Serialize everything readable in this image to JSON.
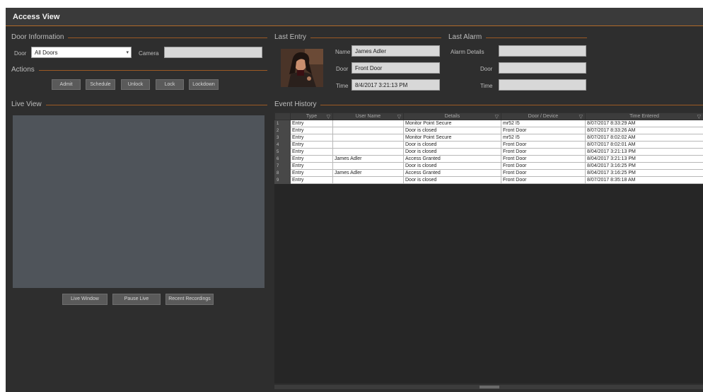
{
  "window": {
    "title": "Access View"
  },
  "door_information": {
    "section_label": "Door Information",
    "door_label": "Door",
    "door_value": "All Doors",
    "camera_label": "Camera",
    "camera_value": ""
  },
  "actions": {
    "section_label": "Actions",
    "buttons": [
      "Admit",
      "Schedule",
      "Unlock",
      "Lock",
      "Lockdown"
    ]
  },
  "live_view": {
    "section_label": "Live View",
    "buttons": [
      "Live Window",
      "Pause Live",
      "Recent Recordings"
    ]
  },
  "last_entry": {
    "section_label": "Last Entry",
    "name_label": "Name",
    "name_value": "James Adler",
    "door_label": "Door",
    "door_value": "Front Door",
    "time_label": "Time",
    "time_value": "8/4/2017 3:21:13 PM"
  },
  "last_alarm": {
    "section_label": "Last Alarm",
    "details_label": "Alarm Details",
    "details_value": "",
    "door_label": "Door",
    "door_value": "",
    "time_label": "Time",
    "time_value": ""
  },
  "event_history": {
    "section_label": "Event History",
    "columns": [
      "Type",
      "User Name",
      "Details",
      "Door / Device",
      "Time Entered"
    ],
    "rows": [
      {
        "num": "1",
        "type": "Entry",
        "user": "",
        "details": "Monitor Point Secure",
        "door": "mr52 I5",
        "time": "8/07/2017 8:33:29 AM"
      },
      {
        "num": "2",
        "type": "Entry",
        "user": "",
        "details": "Door is closed",
        "door": "Front Door",
        "time": "8/07/2017 8:33:26 AM"
      },
      {
        "num": "3",
        "type": "Entry",
        "user": "",
        "details": "Monitor Point Secure",
        "door": "mr52 I5",
        "time": "8/07/2017 8:02:02 AM"
      },
      {
        "num": "4",
        "type": "Entry",
        "user": "",
        "details": "Door is closed",
        "door": "Front Door",
        "time": "8/07/2017 8:02:01 AM"
      },
      {
        "num": "5",
        "type": "Entry",
        "user": "",
        "details": "Door is closed",
        "door": "Front Door",
        "time": "8/04/2017 3:21:13 PM"
      },
      {
        "num": "6",
        "type": "Entry",
        "user": "James Adler",
        "details": "Access Granted",
        "door": "Front Door",
        "time": "8/04/2017 3:21:13 PM"
      },
      {
        "num": "7",
        "type": "Entry",
        "user": "",
        "details": "Door is closed",
        "door": "Front Door",
        "time": "8/04/2017 3:16:25 PM"
      },
      {
        "num": "8",
        "type": "Entry",
        "user": "James Adler",
        "details": "Access Granted",
        "door": "Front Door",
        "time": "8/04/2017 3:16:25 PM"
      },
      {
        "num": "9",
        "type": "Entry",
        "user": "",
        "details": "Door is closed",
        "door": "Front Door",
        "time": "8/07/2017 8:35:18 AM"
      }
    ]
  },
  "icons": {
    "dropdown": "chevron-down-icon",
    "filter": "filter-icon"
  },
  "colors": {
    "accent": "#9c5a24",
    "background": "#2e2e2e",
    "live_view_canvas": "#4f545a"
  }
}
